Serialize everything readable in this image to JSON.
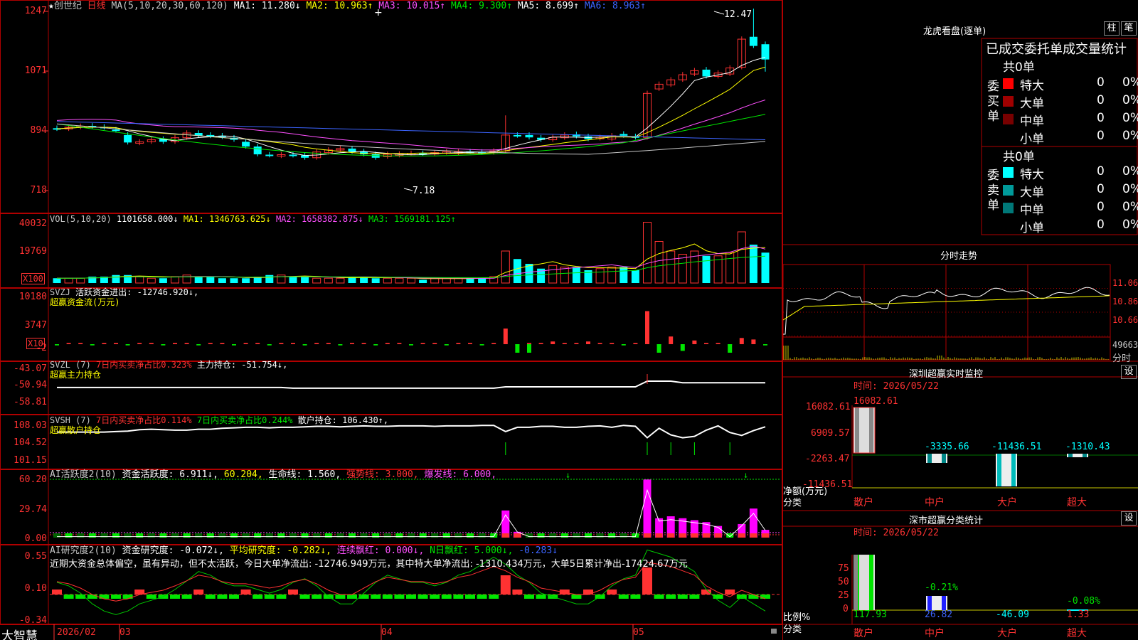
{
  "stock": {
    "star": "★",
    "name": "创世纪",
    "period": "日线"
  },
  "ma_line": {
    "label": "MA(5,10,20,30,60,120)",
    "ma1": "MA1: 11.280↓",
    "ma2": "MA2: 10.963↑",
    "ma3": "MA3: 10.015↑",
    "ma4": "MA4: 9.300↑",
    "ma5": "MA5: 8.699↑",
    "ma6": "MA6: 8.963↑"
  },
  "price_axis": [
    "1247",
    "1071",
    "894",
    "718"
  ],
  "price_marks": {
    "high": "12.47",
    "low": "7.18"
  },
  "vol": {
    "label": "VOL(5,10,20)",
    "value": "1101658.000↓",
    "ma1": "MA1: 1346763.625↓",
    "ma2": "MA2: 1658382.875↓",
    "ma3": "MA3: 1569181.125↑",
    "axis": [
      "40032",
      "19769"
    ],
    "mult": "X100"
  },
  "svzj": {
    "label": "SVZJ",
    "title": "活跃资金进出: -12746.920↓,",
    "sub": "超赢资金流(万元)",
    "axis": [
      "10180",
      "3747",
      "-2"
    ],
    "mult": "X10"
  },
  "svzl": {
    "label": "SVZL  (7)",
    "t1": "7日内买卖净占比0.323%",
    "t2": "主力持仓: -51.754↓,",
    "sub": "超赢主力持仓",
    "axis": [
      "-43.07",
      "-50.94",
      "-58.81"
    ]
  },
  "svsh": {
    "label": "SVSH  (7)",
    "t1": "7日内买卖净占比0.114%",
    "t2": "7日内买卖净占比0.244%",
    "t3": "散户持仓: 106.430↑,",
    "sub": "超赢散户持仓",
    "axis": [
      "108.03",
      "104.52",
      "101.15"
    ]
  },
  "ai_act": {
    "label": "AI活跃度2(10)",
    "t1": "资金活跃度: 6.911↓,",
    "t2": "60.204,",
    "t3": "生命线: 1.560,",
    "t4": "强势线: 3.000,",
    "t5": "爆发线: 6.000,",
    "axis": [
      "60.20",
      "29.74",
      "0.00"
    ]
  },
  "ai_res": {
    "label": "AI研究度2(10)",
    "t1": "资金研究度: -0.072↓,",
    "t2": "平均研究度: -0.282↓,",
    "t3": "连续飘红: 0.000↓,",
    "t4": "N日飘红: 5.000↓,",
    "t5": "-0.283↓",
    "desc": "近期大资金总体偏空，虽有异动，但不太活跃，今日大单净流出: -12746.949万元，其中特大单净流出: -1310.434万元，大单5日累计净出-17424.67万元",
    "axis": [
      "0.55",
      "0.10",
      "-0.34"
    ]
  },
  "dates": [
    "2026/02",
    "03",
    "04",
    "05"
  ],
  "brand": "大智慧",
  "lhb": {
    "title": "龙虎看盘(逐单)",
    "btn1": "柱",
    "btn2": "笔",
    "header": "已成交委托单成交量统计",
    "buy": {
      "label": "委买单",
      "total": "共0单",
      "rows": [
        {
          "name": "特大",
          "num": "0",
          "pct": "0%",
          "color": "#ff0000"
        },
        {
          "name": "大单",
          "num": "0",
          "pct": "0%",
          "color": "#a00000"
        },
        {
          "name": "中单",
          "num": "0",
          "pct": "0%",
          "color": "#780000"
        },
        {
          "name": "小单",
          "num": "0",
          "pct": "0%",
          "color": ""
        }
      ]
    },
    "sell": {
      "label": "委卖单",
      "total": "共0单",
      "rows": [
        {
          "name": "特大",
          "num": "0",
          "pct": "0%",
          "color": "#00ffff"
        },
        {
          "name": "大单",
          "num": "0",
          "pct": "0%",
          "color": "#009a9a"
        },
        {
          "name": "中单",
          "num": "0",
          "pct": "0%",
          "color": "#007878"
        },
        {
          "name": "小单",
          "num": "0",
          "pct": "0%",
          "color": ""
        }
      ]
    }
  },
  "intraday": {
    "title": "分时走势",
    "axis": [
      "11.06",
      "10.86",
      "10.66"
    ],
    "vol": "49663",
    "unit": "分时"
  },
  "sz_monitor": {
    "title": "深圳超赢实时监控",
    "btn": "设",
    "time": "时间: 2026/05/22",
    "axis": [
      "16082.61",
      "6909.57",
      "-2263.47",
      "-11436.51"
    ],
    "values": [
      "16082.61",
      "-3335.66",
      "-11436.51",
      "-1310.43"
    ],
    "ylabel": "净额(万元)",
    "xlabel": "分类",
    "cats": [
      "散户",
      "中户",
      "大户",
      "超大"
    ]
  },
  "sz_class": {
    "title": "深市超赢分类统计",
    "btn": "设",
    "time": "时间: 2026/05/22",
    "axis": [
      "75",
      "50",
      "25",
      "0"
    ],
    "values": [
      "117.93",
      "26.82",
      "-46.09",
      "1.33"
    ],
    "pcts": [
      "-0.21%",
      "-0.08%"
    ],
    "ylabel": "比例%",
    "xlabel": "分类",
    "cats": [
      "散户",
      "中户",
      "大户",
      "超大"
    ]
  },
  "colors": {
    "up": "#ff3232",
    "down": "#00ffff",
    "grid": "#b00000"
  }
}
